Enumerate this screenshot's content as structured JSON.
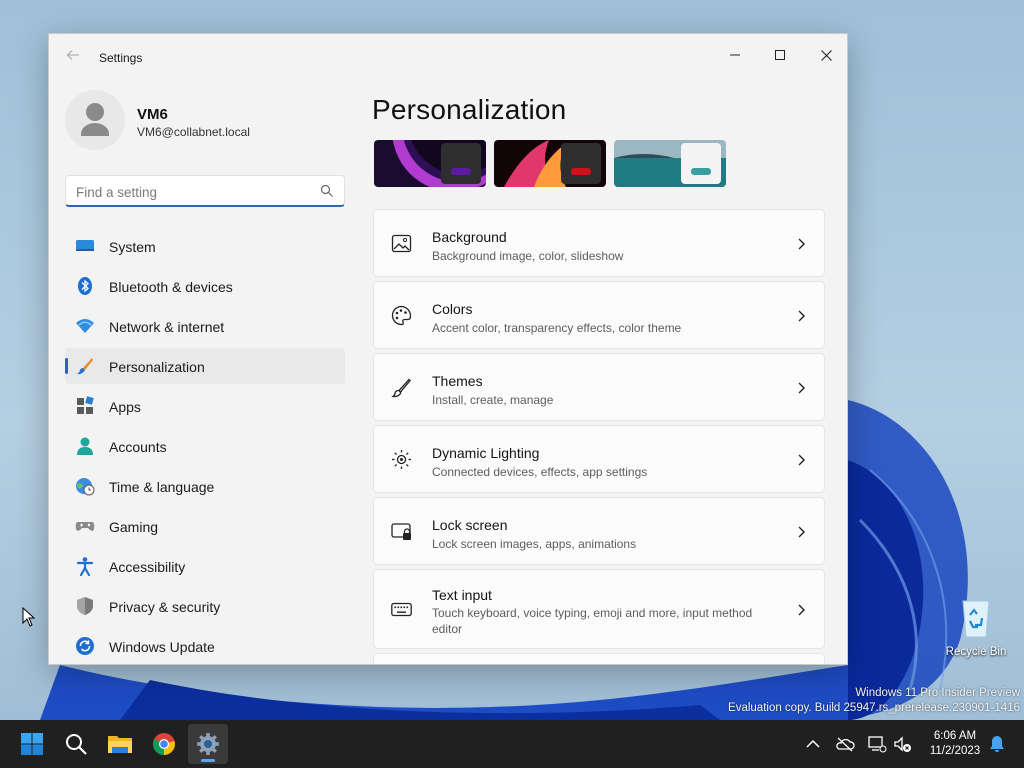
{
  "window": {
    "app_title": "Settings",
    "user": {
      "name": "VM6",
      "email": "VM6@collabnet.local"
    },
    "search": {
      "placeholder": "Find a setting"
    },
    "nav": [
      {
        "label": "System",
        "icon": "system-icon"
      },
      {
        "label": "Bluetooth & devices",
        "icon": "bluetooth-icon"
      },
      {
        "label": "Network & internet",
        "icon": "wifi-icon"
      },
      {
        "label": "Personalization",
        "icon": "brush-icon",
        "active": true
      },
      {
        "label": "Apps",
        "icon": "apps-icon"
      },
      {
        "label": "Accounts",
        "icon": "person-icon"
      },
      {
        "label": "Time & language",
        "icon": "globe-clock-icon"
      },
      {
        "label": "Gaming",
        "icon": "gamepad-icon"
      },
      {
        "label": "Accessibility",
        "icon": "accessibility-icon"
      },
      {
        "label": "Privacy & security",
        "icon": "shield-icon"
      },
      {
        "label": "Windows Update",
        "icon": "update-icon"
      }
    ],
    "page_title": "Personalization",
    "cards": [
      {
        "title": "Background",
        "subtitle": "Background image, color, slideshow",
        "icon": "image-icon"
      },
      {
        "title": "Colors",
        "subtitle": "Accent color, transparency effects, color theme",
        "icon": "palette-icon"
      },
      {
        "title": "Themes",
        "subtitle": "Install, create, manage",
        "icon": "brush-icon"
      },
      {
        "title": "Dynamic Lighting",
        "subtitle": "Connected devices, effects, app settings",
        "icon": "sun-icon"
      },
      {
        "title": "Lock screen",
        "subtitle": "Lock screen images, apps, animations",
        "icon": "lock-screen-icon"
      },
      {
        "title": "Text input",
        "subtitle": "Touch keyboard, voice typing, emoji and more, input method editor",
        "icon": "keyboard-icon"
      }
    ]
  },
  "desktop": {
    "recycle_bin": "Recycle Bin",
    "watermark_line1": "Windows 11 Pro Insider Preview",
    "watermark_line2": "Evaluation copy. Build 25947.rs_prerelease.230901-1416"
  },
  "taskbar": {
    "apps": [
      "start-icon",
      "search-icon",
      "file-explorer-icon",
      "chrome-icon",
      "settings-icon"
    ],
    "time": "6:06 AM",
    "date": "11/2/2023"
  },
  "colors": {
    "accent": "#2f63b5",
    "taskbar": "#202020",
    "window_bg": "#f3f3f3"
  }
}
